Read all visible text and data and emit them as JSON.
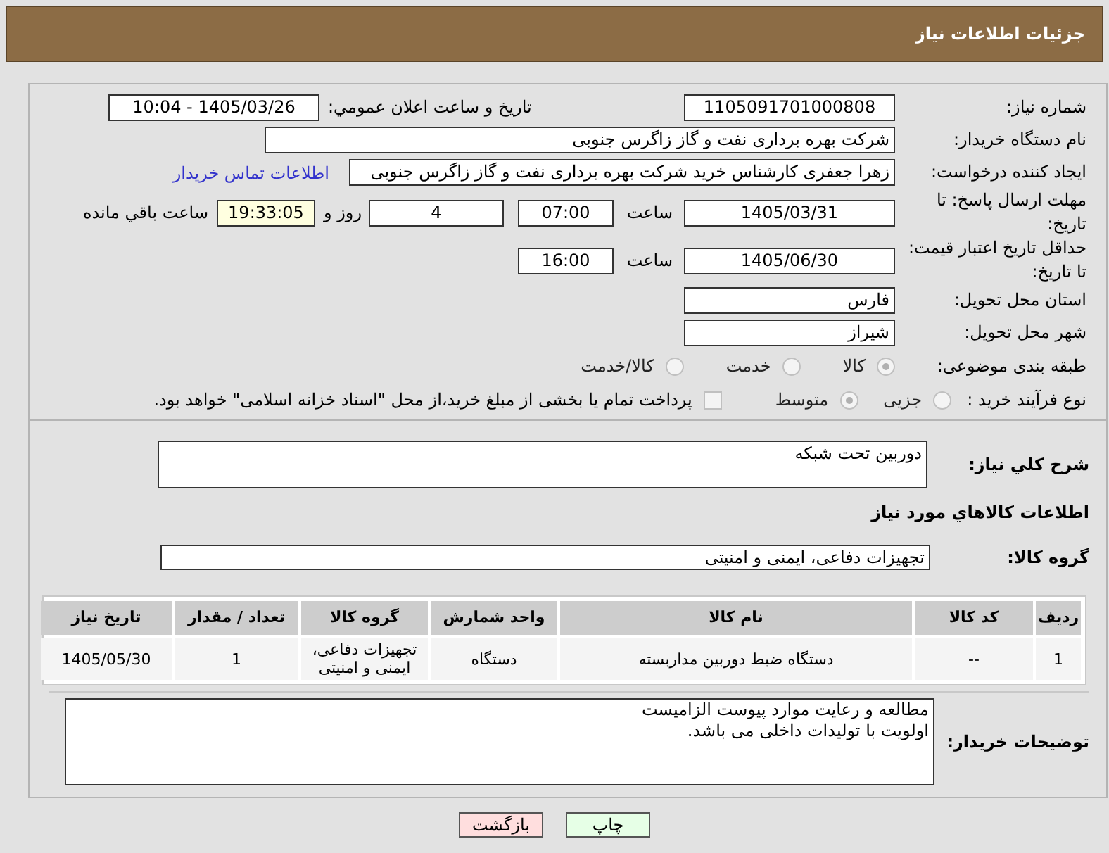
{
  "header": {
    "title": "جزئیات اطلاعات نیاز"
  },
  "need_number": {
    "label": "شماره نیاز:",
    "value": "1105091701000808"
  },
  "announce": {
    "label": "تاریخ و ساعت اعلان عمومي:",
    "value": "1405/03/26 - 10:04"
  },
  "buyer_org": {
    "label": "نام دستگاه خریدار:",
    "value": "شرکت بهره برداری نفت و گاز زاگرس جنوبی"
  },
  "requester": {
    "label": "ایجاد کننده درخواست:",
    "value": "زهرا جعفری کارشناس خرید شرکت بهره برداری نفت و گاز زاگرس جنوبی",
    "link": "اطلاعات تماس خریدار"
  },
  "deadline": {
    "label": "مهلت ارسال پاسخ: تا تاریخ:",
    "date": "1405/03/31",
    "time_label": "ساعت",
    "time": "07:00",
    "days": "4",
    "days_label": "روز و",
    "remaining": "19:33:05",
    "remaining_label": "ساعت باقي مانده"
  },
  "validity": {
    "label": "حداقل تاریخ اعتبار قیمت: تا تاریخ:",
    "date": "1405/06/30",
    "time_label": "ساعت",
    "time": "16:00"
  },
  "province": {
    "label": "استان محل تحویل:",
    "value": "فارس"
  },
  "city": {
    "label": "شهر محل تحویل:",
    "value": "شیراز"
  },
  "category": {
    "label": "طبقه بندی موضوعی:",
    "options": [
      {
        "label": "کالا",
        "selected": true
      },
      {
        "label": "خدمت",
        "selected": false
      },
      {
        "label": "کالا/خدمت",
        "selected": false
      }
    ]
  },
  "process": {
    "label": "نوع فرآیند خرید :",
    "options": [
      {
        "label": "جزیی",
        "selected": false
      },
      {
        "label": "متوسط",
        "selected": true
      }
    ],
    "payment": {
      "label": "پرداخت تمام یا بخشی از مبلغ خرید،از محل \"اسناد خزانه اسلامی\" خواهد بود.",
      "checked": false
    }
  },
  "description": {
    "label": "شرح کلي نیاز:",
    "value": "دوربین تحت شبکه"
  },
  "goods_heading": "اطلاعات کالاهاي مورد نیاز",
  "goods_group": {
    "label": "گروه کالا:",
    "value": "تجهیزات دفاعی، ایمنی و امنیتی"
  },
  "table": {
    "columns": [
      "ردیف",
      "کد کالا",
      "نام کالا",
      "واحد شمارش",
      "گروه کالا",
      "تعداد / مقدار",
      "تاریخ نیاز"
    ],
    "rows": [
      [
        "1",
        "--",
        "دستگاه ضبط دوربین مداربسته",
        "دستگاه",
        "تجهیزات دفاعی، ایمنی و امنیتی",
        "1",
        "1405/05/30"
      ]
    ]
  },
  "buyer_notes": {
    "label": "توضیحات خریدار:",
    "value": "مطالعه و رعایت موارد پیوست الزامیست\nاولویت با تولیدات داخلی می باشد."
  },
  "buttons": [
    {
      "label": "چاپ",
      "kind": "print"
    },
    {
      "label": "بازگشت",
      "kind": "back"
    }
  ]
}
